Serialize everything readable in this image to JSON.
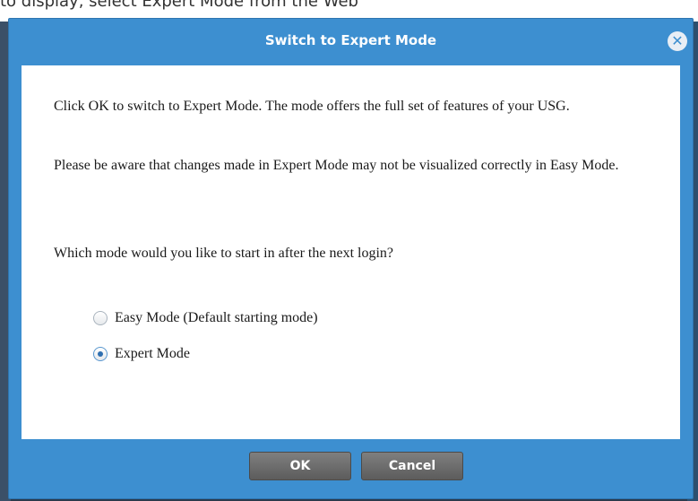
{
  "background": {
    "top_text": "to display, select Expert Mode from the Web"
  },
  "dialog": {
    "title": "Switch to Expert Mode",
    "close_glyph": "✕",
    "paragraph1": "Click OK to switch to Expert Mode. The mode offers the full set of features of your USG.",
    "paragraph2": "Please be aware that changes made in Expert Mode may not be visualized correctly in Easy Mode.",
    "question": "Which mode would you like to start in after the next login?",
    "options": [
      {
        "label": "Easy Mode (Default starting mode)",
        "checked": false
      },
      {
        "label": "Expert Mode",
        "checked": true
      }
    ],
    "ok_label": "OK",
    "cancel_label": "Cancel"
  },
  "colors": {
    "titlebar": "#3d8fd0",
    "button": "#6e6e6e"
  }
}
